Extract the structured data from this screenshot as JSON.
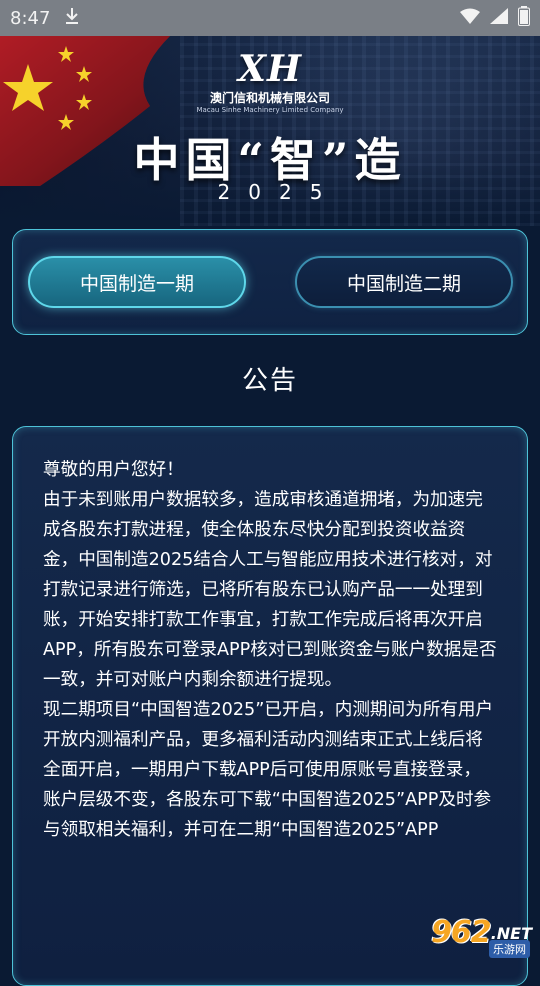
{
  "status_bar": {
    "time": "8:47",
    "icons": [
      "download-icon",
      "wifi-icon",
      "signal-icon",
      "battery-icon"
    ]
  },
  "header": {
    "logo_text": "XH",
    "company_cn": "澳门信和机械有限公司",
    "company_en": "Macau Sinhe Machinery Limited Company",
    "title": "中国“智”造",
    "year": "2025"
  },
  "phase_tabs": [
    {
      "label": "中国制造一期",
      "active": true
    },
    {
      "label": "中国制造二期",
      "active": false
    }
  ],
  "notice": {
    "heading": "公告",
    "body": "尊敬的用户您好！\n由于未到账用户数据较多，造成审核通道拥堵，为加速完成各股东打款进程，使全体股东尽快分配到投资收益资金，中国制造2025结合人工与智能应用技术进行核对，对打款记录进行筛选，已将所有股东已认购产品一一处理到账，开始安排打款工作事宜，打款工作完成后将再次开启APP，所有股东可登录APP核对已到账资金与账户数据是否一致，并可对账户内剩余额进行提现。\n现二期项目“中国智造2025”已开启，内测期间为所有用户开放内测福利产品，更多福利活动内测结束正式上线后将全面开启，一期用户下载APP后可使用原账号直接登录，账户层级不变，各股东可下载“中国智造2025”APP及时参与领取相关福利，并可在二期“中国智造2025”APP"
  },
  "watermark": {
    "main": "962",
    "suffix": ".NET",
    "sub": "乐游网"
  },
  "colors": {
    "background": "#0a1a33",
    "accent_border": "#4ec3d8",
    "active_tab": "#17667f"
  }
}
